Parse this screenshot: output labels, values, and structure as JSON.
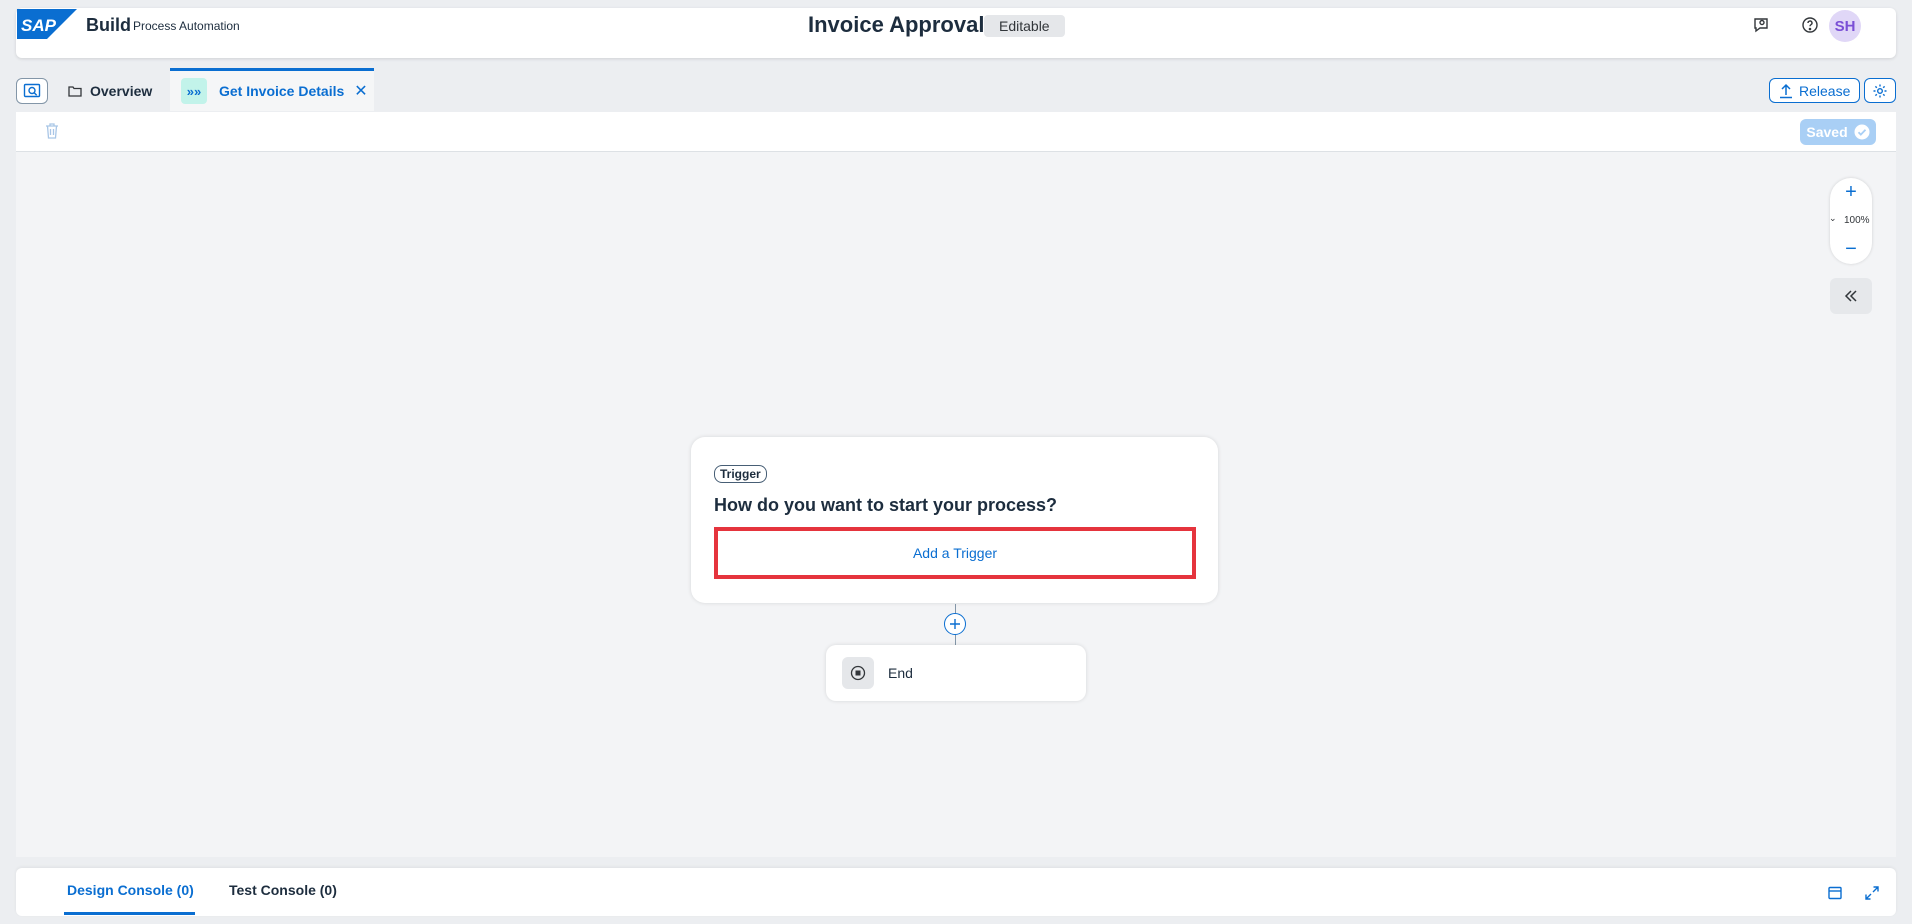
{
  "shell": {
    "logo_text": "SAP",
    "brand": "Build",
    "product": "Process Automation",
    "title": "Invoice Approval",
    "status_badge": "Editable",
    "user_initials": "SH"
  },
  "tabs": {
    "overview_label": "Overview",
    "active_label": "Get Invoice Details"
  },
  "actions": {
    "release_label": "Release",
    "saved_label": "Saved"
  },
  "zoom": {
    "level": "100%"
  },
  "canvas": {
    "trigger_tag": "Trigger",
    "trigger_question": "How do you want to start your process?",
    "add_trigger_label": "Add a Trigger",
    "end_label": "End"
  },
  "console": {
    "tabs": [
      "Design Console (0)",
      "Test Console (0)"
    ]
  },
  "colors": {
    "accent": "#0a6ed1",
    "highlight": "#e5343d",
    "tab_icon_bg": "#c2f3ea",
    "avatar_bg": "#e0d7f7"
  }
}
